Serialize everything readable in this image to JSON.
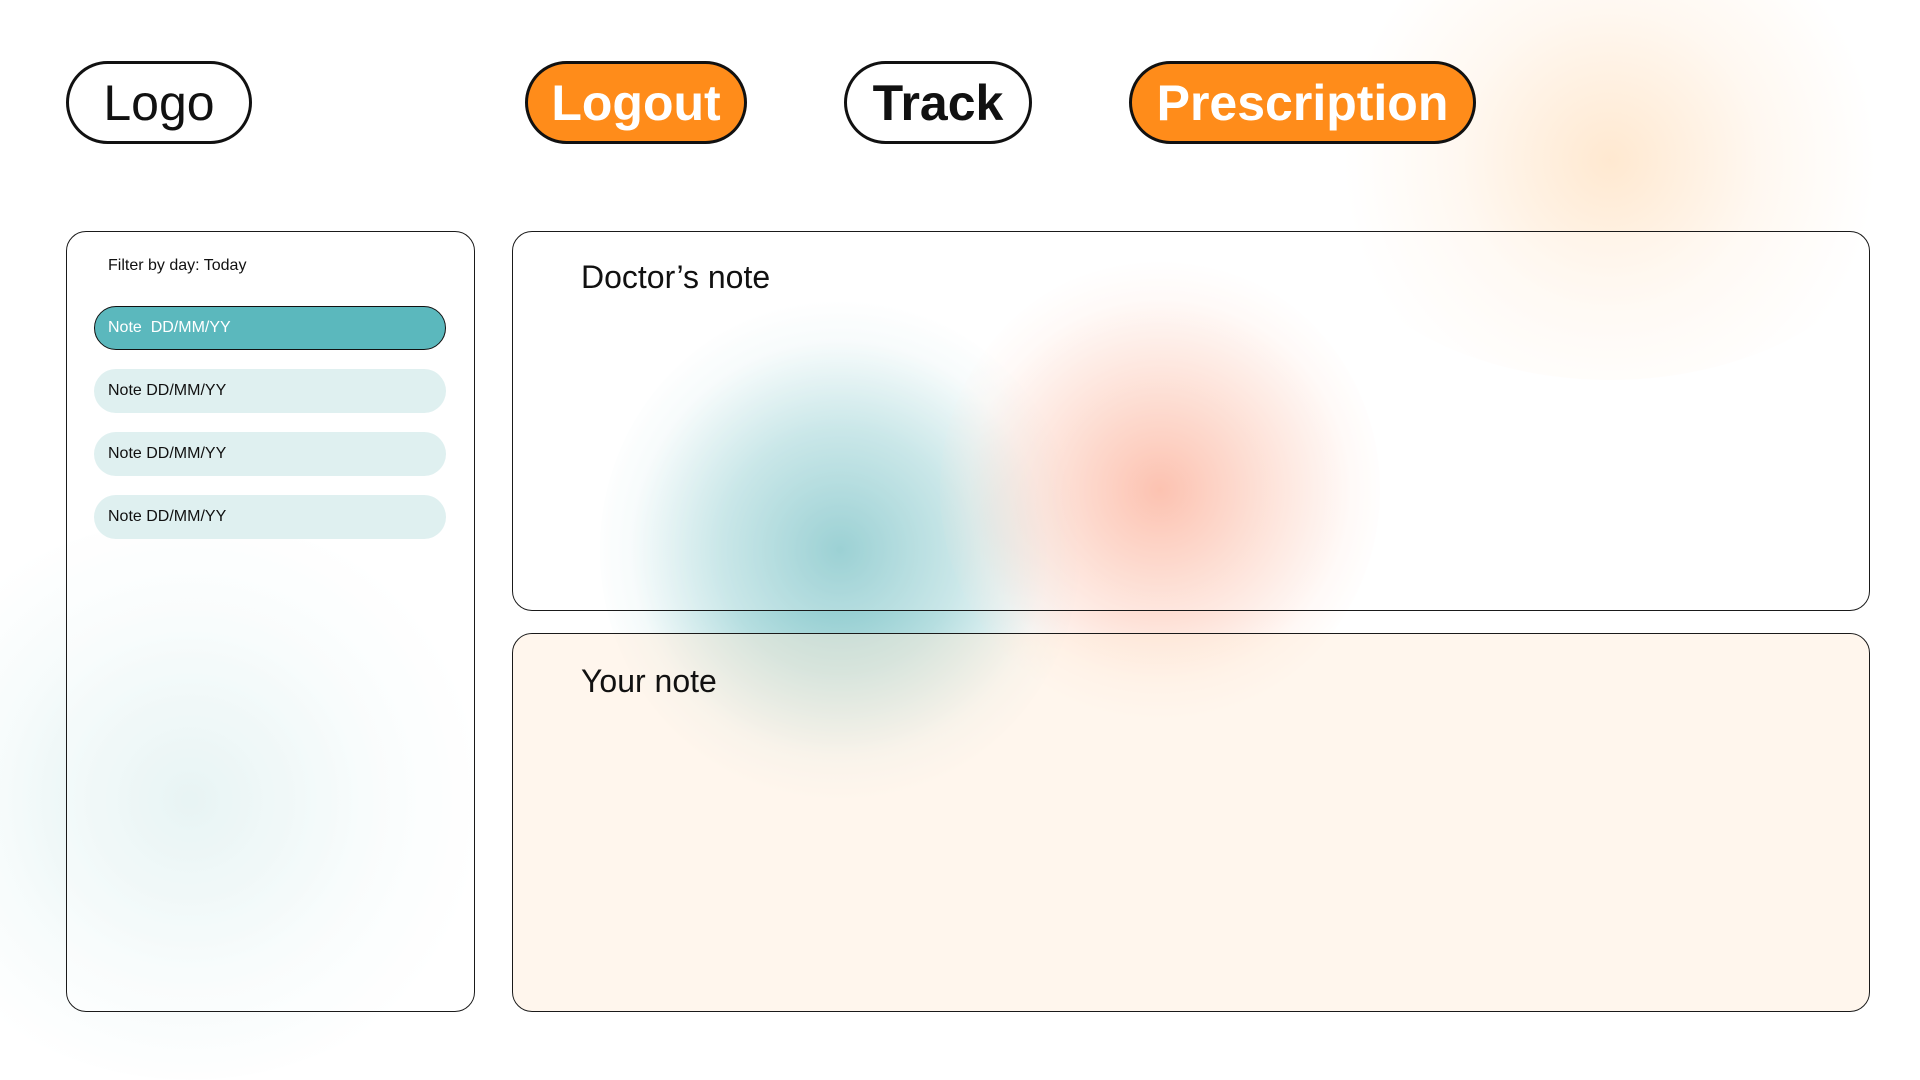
{
  "header": {
    "logo_label": "Logo",
    "logout_label": "Logout",
    "track_label": "Track",
    "prescription_label": "Prescription"
  },
  "sidebar": {
    "filter_label": "Filter by day: Today",
    "items": [
      {
        "label": "Note  DD/MM/YY",
        "active": true
      },
      {
        "label": "Note DD/MM/YY",
        "active": false
      },
      {
        "label": "Note DD/MM/YY",
        "active": false
      },
      {
        "label": "Note DD/MM/YY",
        "active": false
      }
    ]
  },
  "main": {
    "doctor_note": {
      "title": "Doctor’s note"
    },
    "your_note": {
      "title": "Your note"
    }
  },
  "colors": {
    "accent_orange": "#ff8c1a",
    "active_teal": "#5bb8bd",
    "item_bg": "#dff0f0",
    "your_note_bg": "#fff3e6"
  }
}
